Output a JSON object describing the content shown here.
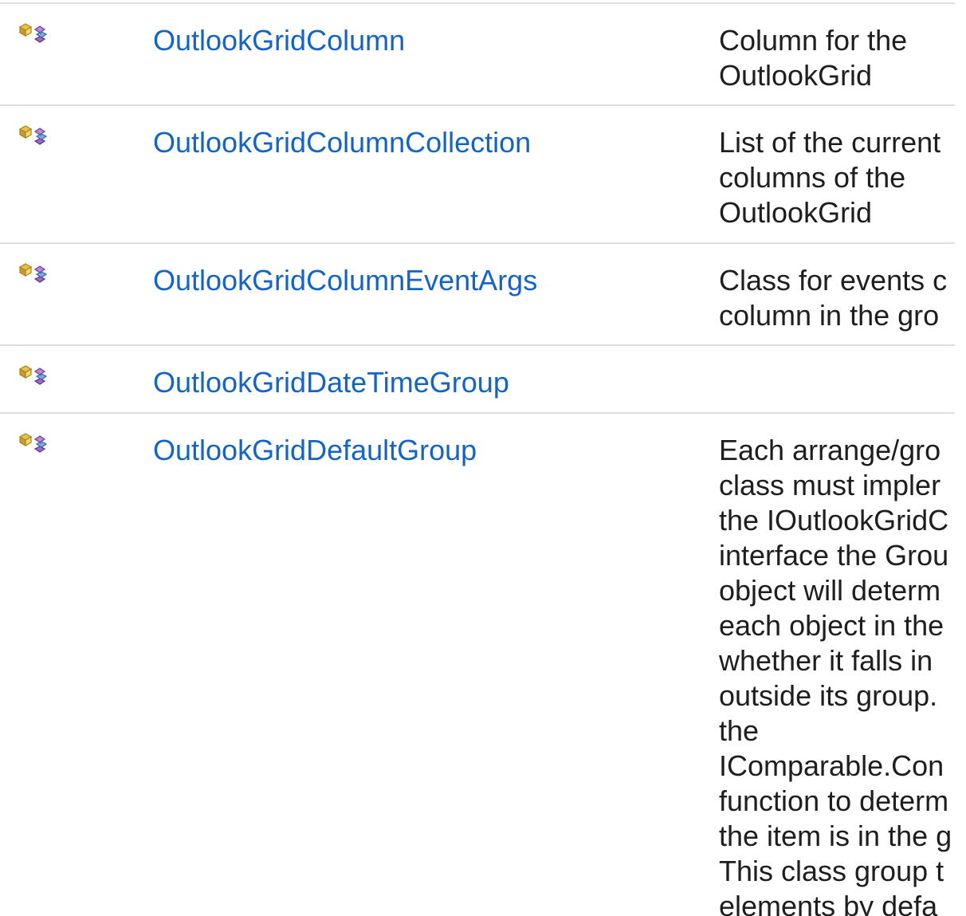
{
  "rows": [
    {
      "name": "OutlookGridColumn",
      "icon": "public-class-icon",
      "description_lines": [
        "Column for the",
        "OutlookGrid"
      ]
    },
    {
      "name": "OutlookGridColumnCollection",
      "icon": "public-class-icon",
      "description_lines": [
        "List of the current",
        "columns of the",
        "OutlookGrid"
      ]
    },
    {
      "name": "OutlookGridColumnEventArgs",
      "icon": "public-class-icon",
      "description_lines": [
        "Class for events c",
        "column in the gro"
      ]
    },
    {
      "name": "OutlookGridDateTimeGroup",
      "icon": "public-class-icon",
      "description_lines": []
    },
    {
      "name": "OutlookGridDefaultGroup",
      "icon": "public-class-icon",
      "description_lines": [
        "Each arrange/gro",
        "class must impler",
        "the IOutlookGridC",
        "interface the Grou",
        "object will determ",
        "each object in the",
        "whether it falls in",
        "outside its group.",
        "the",
        "IComparable.Con",
        "function to determ",
        "the item is in the g",
        "This class group t",
        "elements by defa"
      ]
    }
  ],
  "colors": {
    "link": "#1364c4",
    "text": "#1e1e1e",
    "rule": "#dedede"
  }
}
